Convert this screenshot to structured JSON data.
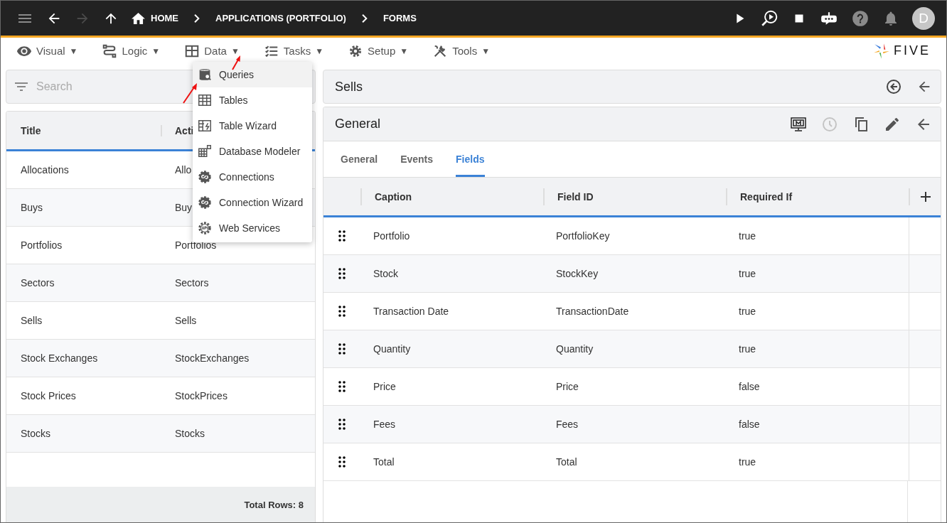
{
  "topbar": {
    "nav_buttons": [
      {
        "disabled": false
      },
      {
        "disabled": true
      },
      {
        "disabled": false
      }
    ],
    "breadcrumbs": [
      {
        "label": "HOME"
      },
      {
        "label": "APPLICATIONS (PORTFOLIO)"
      },
      {
        "label": "FORMS"
      }
    ],
    "avatar": "D"
  },
  "menubar": {
    "items": [
      {
        "label": "Visual",
        "caret": "▼"
      },
      {
        "label": "Logic",
        "caret": "▼"
      },
      {
        "label": "Data",
        "caret": "▼"
      },
      {
        "label": "Tasks",
        "caret": "▼"
      },
      {
        "label": "Setup",
        "caret": "▼"
      },
      {
        "label": "Tools",
        "caret": "▼"
      }
    ],
    "logo": "FIVE"
  },
  "dropdown": {
    "items": [
      {
        "label": "Queries",
        "selected": true
      },
      {
        "label": "Tables",
        "selected": false
      },
      {
        "label": "Table Wizard",
        "selected": false
      },
      {
        "label": "Database Modeler",
        "selected": false
      },
      {
        "label": "Connections",
        "selected": false
      },
      {
        "label": "Connection Wizard",
        "selected": false
      },
      {
        "label": "Web Services",
        "selected": false
      }
    ]
  },
  "left": {
    "search": {
      "placeholder": "Search"
    },
    "columns": [
      "Title",
      "Acti"
    ],
    "rows": [
      [
        "Allocations",
        "Allo"
      ],
      [
        "Buys",
        "Buy"
      ],
      [
        "Portfolios",
        "Portfolios"
      ],
      [
        "Sectors",
        "Sectors"
      ],
      [
        "Sells",
        "Sells"
      ],
      [
        "Stock Exchanges",
        "StockExchanges"
      ],
      [
        "Stock Prices",
        "StockPrices"
      ],
      [
        "Stocks",
        "Stocks"
      ]
    ],
    "footer": "Total Rows: 8"
  },
  "right": {
    "title": "Sells",
    "card": {
      "title": "General",
      "actions": [
        {
          "disabled": false
        },
        {
          "disabled": true
        },
        {
          "disabled": false
        },
        {
          "disabled": false
        },
        {
          "disabled": false
        }
      ],
      "tabs": [
        {
          "label": "General",
          "selected": false
        },
        {
          "label": "Events",
          "selected": false
        },
        {
          "label": "Fields",
          "selected": true
        }
      ],
      "columns": [
        "Caption",
        "Field ID",
        "Required If"
      ],
      "rows": [
        [
          "Portfolio",
          "PortfolioKey",
          "true"
        ],
        [
          "Stock",
          "StockKey",
          "true"
        ],
        [
          "Transaction Date",
          "TransactionDate",
          "true"
        ],
        [
          "Quantity",
          "Quantity",
          "true"
        ],
        [
          "Price",
          "Price",
          "false"
        ],
        [
          "Fees",
          "Fees",
          "false"
        ],
        [
          "Total",
          "Total",
          "true"
        ]
      ]
    }
  }
}
